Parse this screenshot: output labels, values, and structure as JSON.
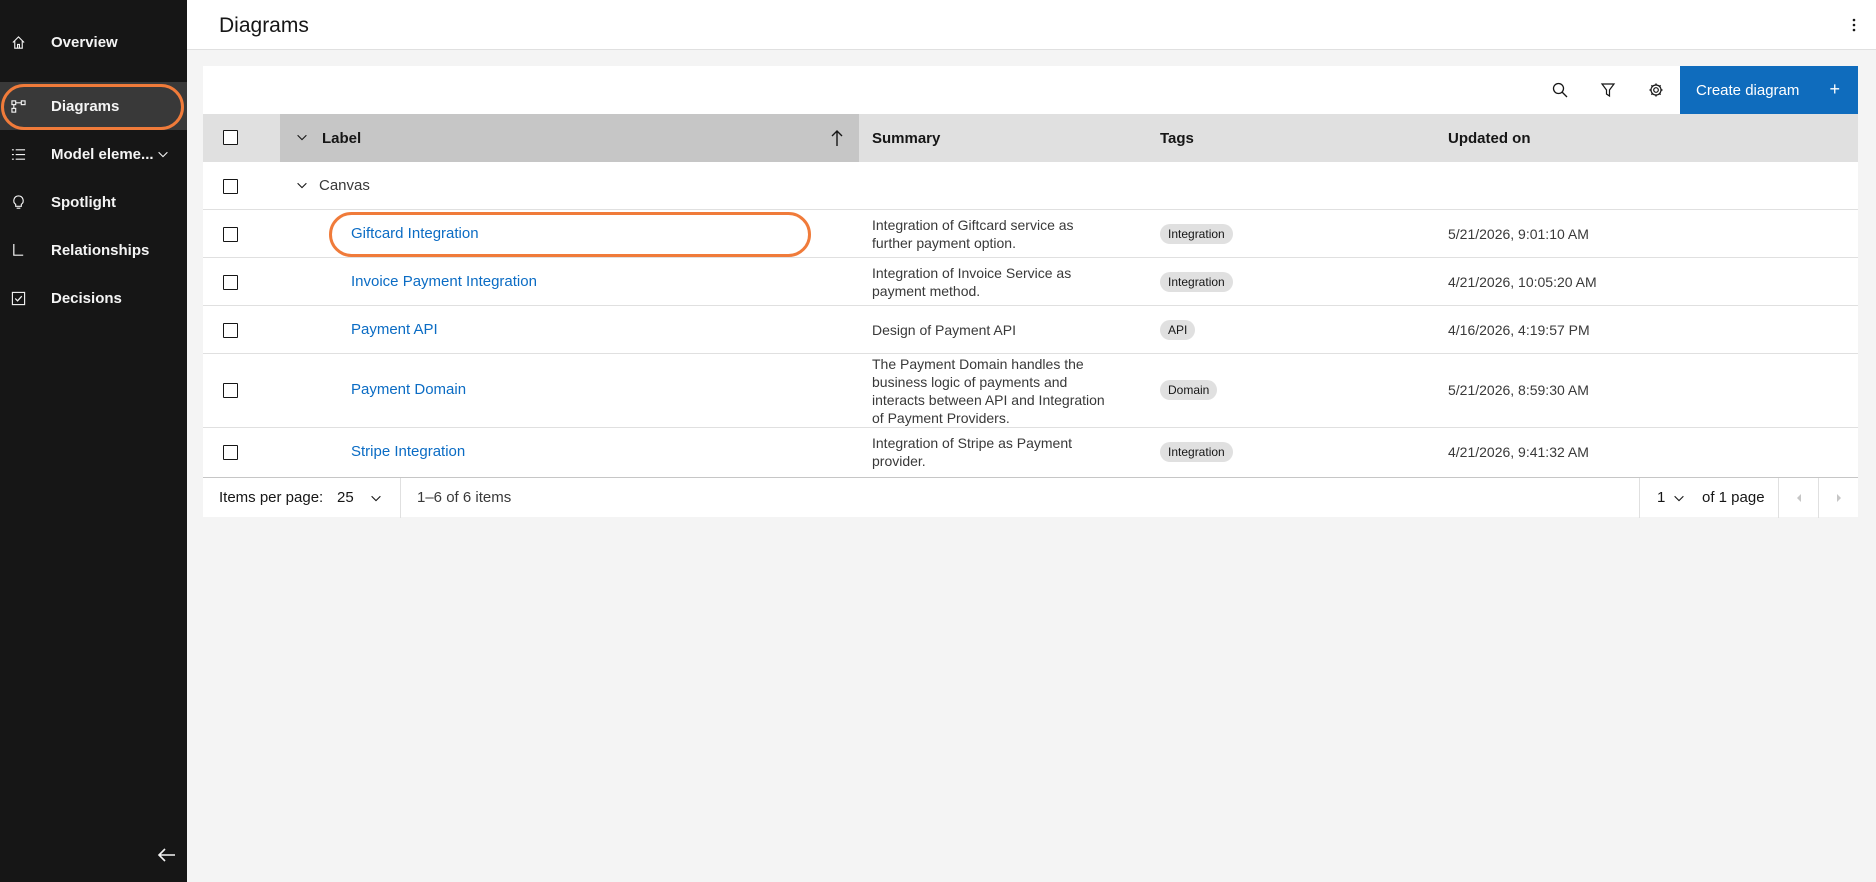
{
  "sidebar": {
    "items": [
      {
        "label": "Overview",
        "icon": "home-icon"
      },
      {
        "label": "Diagrams",
        "icon": "diagram-icon"
      },
      {
        "label": "Model eleme...",
        "icon": "list-icon"
      },
      {
        "label": "Spotlight",
        "icon": "lightbulb-icon"
      },
      {
        "label": "Relationships",
        "icon": "relationship-icon"
      },
      {
        "label": "Decisions",
        "icon": "checkbox-icon"
      }
    ]
  },
  "header": {
    "title": "Diagrams"
  },
  "toolbar": {
    "create_label": "Create diagram",
    "create_plus": "+"
  },
  "table": {
    "columns": [
      "Label",
      "Summary",
      "Tags",
      "Updated on"
    ],
    "group": "Canvas",
    "rows": [
      {
        "label": "Giftcard Integration",
        "summary": [
          "Integration of Giftcard service as",
          "further payment option."
        ],
        "tag": "Integration",
        "updated": "5/21/2026, 9:01:10 AM"
      },
      {
        "label": "Invoice Payment Integration",
        "summary": [
          "Integration of Invoice Service as",
          "payment method."
        ],
        "tag": "Integration",
        "updated": "4/21/2026, 10:05:20 AM"
      },
      {
        "label": "Payment API",
        "summary": [
          "Design of Payment API"
        ],
        "tag": "API",
        "updated": "4/16/2026, 4:19:57 PM"
      },
      {
        "label": "Payment Domain",
        "summary": [
          "The Payment Domain handles the",
          "business logic of payments and",
          "interacts between API and Integration",
          "of Payment Providers."
        ],
        "tag": "Domain",
        "updated": "5/21/2026, 8:59:30 AM"
      },
      {
        "label": "Stripe Integration",
        "summary": [
          "Integration of Stripe as Payment",
          "provider."
        ],
        "tag": "Integration",
        "updated": "4/21/2026, 9:41:32 AM"
      }
    ]
  },
  "pagination": {
    "items_per_page_label": "Items per page:",
    "items_per_page": "25",
    "range": "1–6 of 6 items",
    "page": "1",
    "of_pages": "of 1 page"
  },
  "colors": {
    "accent": "#0b6cc4",
    "highlight": "#f07b3a",
    "sidebar_bg": "#161616"
  }
}
